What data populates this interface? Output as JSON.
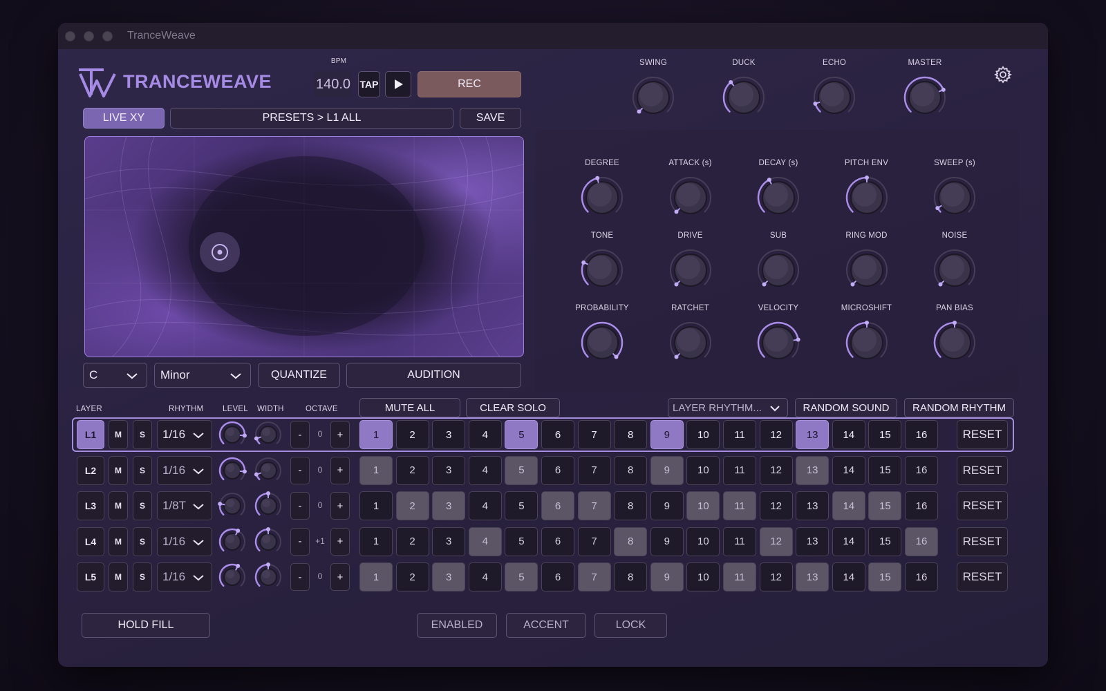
{
  "window": {
    "title": "TranceWeave"
  },
  "app": {
    "name": "TRANCEWEAVE"
  },
  "transport": {
    "bpm_label": "BPM",
    "bpm_value": "140.0",
    "tap_label": "TAP",
    "rec_label": "REC"
  },
  "header": {
    "live_xy_label": "LIVE XY",
    "preset_path": "PRESETS > L1 ALL",
    "save_label": "SAVE"
  },
  "master_knobs": [
    {
      "label": "SWING",
      "value": 0.0
    },
    {
      "label": "DUCK",
      "value": 0.35
    },
    {
      "label": "ECHO",
      "value": 0.1
    },
    {
      "label": "MASTER",
      "value": 0.75
    }
  ],
  "synth_knobs": [
    {
      "label": "DEGREE",
      "value": 0.45
    },
    {
      "label": "ATTACK (s)",
      "value": 0.0
    },
    {
      "label": "DECAY (s)",
      "value": 0.4
    },
    {
      "label": "PITCH ENV",
      "value": 0.5
    },
    {
      "label": "SWEEP (s)",
      "value": 0.05
    },
    {
      "label": "TONE",
      "value": 0.25
    },
    {
      "label": "DRIVE",
      "value": 0.0
    },
    {
      "label": "SUB",
      "value": 0.0
    },
    {
      "label": "RING MOD",
      "value": 0.0
    },
    {
      "label": "NOISE",
      "value": 0.0
    },
    {
      "label": "PROBABILITY",
      "value": 1.0
    },
    {
      "label": "RATCHET",
      "value": 0.0
    },
    {
      "label": "VELOCITY",
      "value": 0.8
    },
    {
      "label": "MICROSHIFT",
      "value": 0.5
    },
    {
      "label": "PAN BIAS",
      "value": 0.5
    }
  ],
  "scale": {
    "root": "C",
    "mode": "Minor",
    "quantize_label": "QUANTIZE",
    "audition_label": "AUDITION"
  },
  "seq_header": {
    "layer": "LAYER",
    "rhythm": "RHYTHM",
    "level": "LEVEL",
    "width": "WIDTH",
    "octave": "OCTAVE",
    "mute_all": "MUTE ALL",
    "clear_solo": "CLEAR SOLO",
    "layer_rhythm": "LAYER RHYTHM...",
    "random_sound": "RANDOM SOUND",
    "random_rhythm": "RANDOM RHYTHM"
  },
  "layers": [
    {
      "name": "L1",
      "rhythm": "1/16",
      "octave": "0",
      "level": 0.85,
      "width": 0.1,
      "steps_on": [
        1,
        5,
        9,
        13
      ],
      "reset": "RESET",
      "m": "M",
      "s": "S",
      "minus": "-",
      "plus": "+"
    },
    {
      "name": "L2",
      "rhythm": "1/16",
      "octave": "0",
      "level": 0.85,
      "width": 0.1,
      "steps_on": [
        1,
        5,
        9,
        13
      ],
      "reset": "RESET",
      "m": "M",
      "s": "S",
      "minus": "-",
      "plus": "+"
    },
    {
      "name": "L3",
      "rhythm": "1/8T",
      "octave": "0",
      "level": 0.2,
      "width": 0.5,
      "steps_on": [
        2,
        3,
        6,
        7,
        10,
        11,
        14,
        15
      ],
      "reset": "RESET",
      "m": "M",
      "s": "S",
      "minus": "-",
      "plus": "+"
    },
    {
      "name": "L4",
      "rhythm": "1/16",
      "octave": "+1",
      "level": 0.6,
      "width": 0.5,
      "steps_on": [
        4,
        8,
        12,
        16
      ],
      "reset": "RESET",
      "m": "M",
      "s": "S",
      "minus": "-",
      "plus": "+"
    },
    {
      "name": "L5",
      "rhythm": "1/16",
      "octave": "0",
      "level": 0.6,
      "width": 0.5,
      "steps_on": [
        1,
        3,
        5,
        7,
        9,
        11,
        13,
        15
      ],
      "reset": "RESET",
      "m": "M",
      "s": "S",
      "minus": "-",
      "plus": "+"
    }
  ],
  "step_numbers": [
    "1",
    "2",
    "3",
    "4",
    "5",
    "6",
    "7",
    "8",
    "9",
    "10",
    "11",
    "12",
    "13",
    "14",
    "15",
    "16"
  ],
  "footer": {
    "hold_fill": "HOLD FILL",
    "enabled": "ENABLED",
    "accent": "ACCENT",
    "lock": "LOCK"
  },
  "colors": {
    "accent": "#9d82e0",
    "rec": "#7a5a5c",
    "highlight": "#8f79c4"
  },
  "icons": {
    "settings": "gear-icon",
    "play": "play-icon",
    "chevron": "chevron-down-icon",
    "xy": "target-icon"
  }
}
